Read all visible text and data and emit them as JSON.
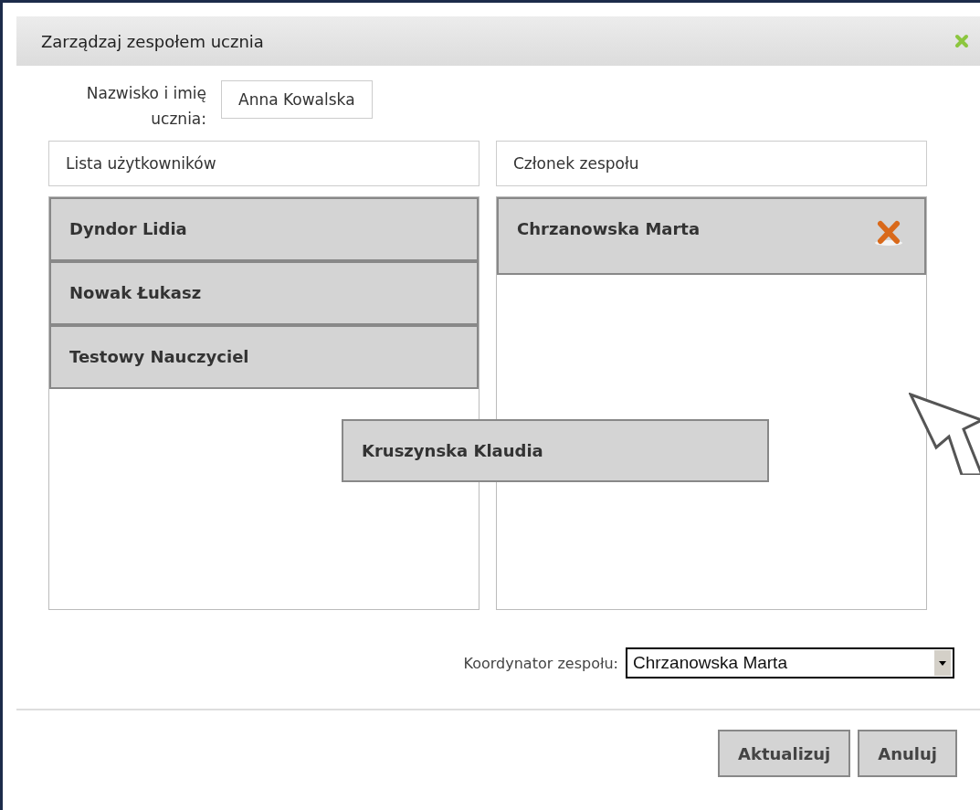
{
  "dialog": {
    "title": "Zarządzaj zespołem ucznia"
  },
  "student": {
    "label": "Nazwisko i imię ucznia:",
    "value": "Anna Kowalska"
  },
  "available_list": {
    "header": "Lista użytkowników",
    "items": [
      {
        "name": "Dyndor Lidia"
      },
      {
        "name": "Nowak Łukasz"
      },
      {
        "name": "Testowy Nauczyciel"
      }
    ]
  },
  "team_list": {
    "header": "Członek zespołu",
    "items": [
      {
        "name": "Chrzanowska Marta"
      }
    ]
  },
  "dragged_item": {
    "name": "Kruszynska Klaudia"
  },
  "coordinator": {
    "label": "Koordynator zespołu:",
    "value": "Chrzanowska Marta"
  },
  "buttons": [
    "Aktualizuj",
    "Anuluj"
  ]
}
